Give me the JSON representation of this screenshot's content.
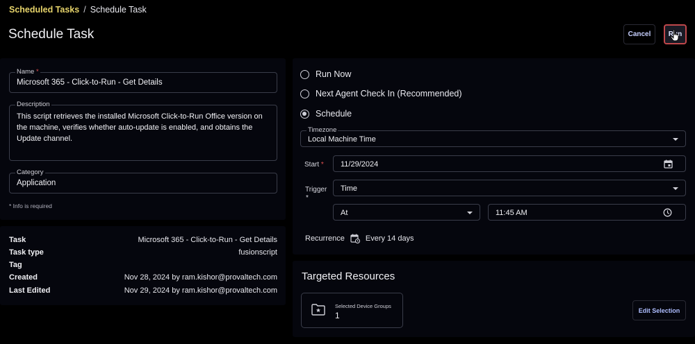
{
  "breadcrumb": {
    "parent": "Scheduled Tasks",
    "separator": "/",
    "current": "Schedule Task"
  },
  "page": {
    "title": "Schedule Task"
  },
  "actions": {
    "cancel_label": "Cancel",
    "run_label": "Run"
  },
  "form": {
    "name_label": "Name",
    "name_value": "Microsoft 365 - Click-to-Run - Get Details",
    "description_label": "Description",
    "description_value": "This script retrieves the installed Microsoft Click-to-Run Office version on the machine, verifies whether auto-update is enabled, and obtains the Update channel.",
    "category_label": "Category",
    "category_value": "Application",
    "required_note": "* Info is required",
    "required_mark": "*"
  },
  "info": {
    "rows": [
      {
        "key": "Task",
        "value": "Microsoft 365 - Click-to-Run - Get Details"
      },
      {
        "key": "Task type",
        "value": "fusionscript"
      },
      {
        "key": "Tag",
        "value": ""
      },
      {
        "key": "Created",
        "value": "Nov 28, 2024 by ram.kishor@provaltech.com"
      },
      {
        "key": "Last Edited",
        "value": "Nov 29, 2024 by ram.kishor@provaltech.com"
      }
    ]
  },
  "schedule": {
    "options": [
      {
        "label": "Run Now",
        "checked": false
      },
      {
        "label": "Next Agent Check In (Recommended)",
        "checked": false
      },
      {
        "label": "Schedule",
        "checked": true
      }
    ],
    "timezone_label": "Timezone",
    "timezone_value": "Local Machine Time",
    "start_label": "Start",
    "start_value": "11/29/2024",
    "trigger_label": "Trigger",
    "trigger_value": "Time",
    "at_value": "At",
    "time_value": "11:45 AM",
    "recurrence_label": "Recurrence",
    "recurrence_value": "Every 14 days"
  },
  "targeted": {
    "title": "Targeted Resources",
    "group_label": "Selected Device Groups",
    "group_count": "1",
    "edit_label": "Edit Selection"
  },
  "colors": {
    "accent": "#e6d36a",
    "run_border": "#c0474b",
    "link_blue": "#aebdff"
  }
}
